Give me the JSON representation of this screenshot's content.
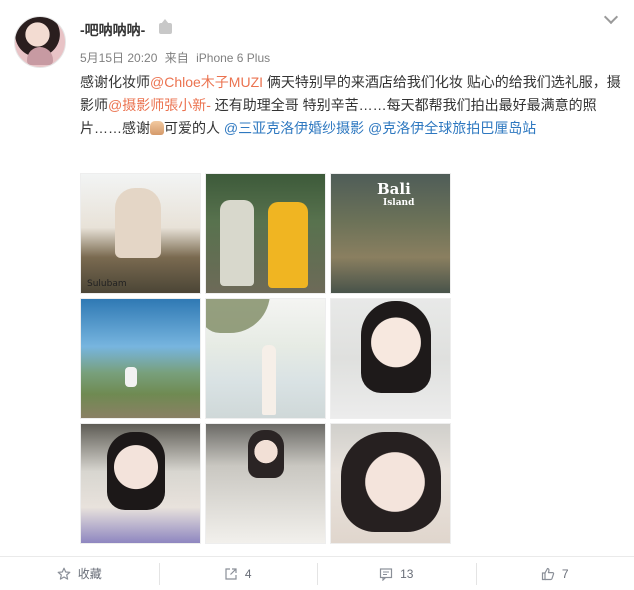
{
  "post": {
    "username": "-吧呐呐呐-",
    "time": "5月15日 20:20",
    "source_prefix": "来自",
    "source": "iPhone 6 Plus",
    "content": {
      "p1": "感谢化妆师",
      "mention1": "@Chloe木子MUZI",
      "p2": " 俩天特别早的来酒店给我们化妆 贴心的给我们选礼服，摄影师",
      "mention2": "@摄影师張小新-",
      "p3": " 还有助理全哥 特别辛苦……每天都帮我们拍出最好最满意的照片……感谢",
      "p4": "可爱的人 ",
      "mention3": "@三亚克洛伊婚纱摄影",
      "mention4": " @克洛伊全球旅拍巴厘岛站"
    },
    "photos": [
      {
        "watermark": "Sulubam"
      },
      {
        "watermark": ""
      },
      {
        "title": "Bali",
        "subtitle": "Island"
      },
      {
        "watermark": ""
      },
      {
        "watermark": ""
      },
      {
        "watermark": ""
      },
      {
        "watermark": ""
      },
      {
        "watermark": ""
      },
      {
        "watermark": ""
      }
    ]
  },
  "actions": {
    "favorite_label": "收藏",
    "repost_count": "4",
    "comment_count": "13",
    "like_count": "7"
  },
  "icons": {
    "favorite": "star-icon",
    "repost": "share-icon",
    "comment": "comment-icon",
    "like": "thumbs-up-icon",
    "more": "chevron-down-icon"
  },
  "colors": {
    "mention": "#eb7350",
    "topic": "#2e78c0",
    "meta": "#808080"
  }
}
